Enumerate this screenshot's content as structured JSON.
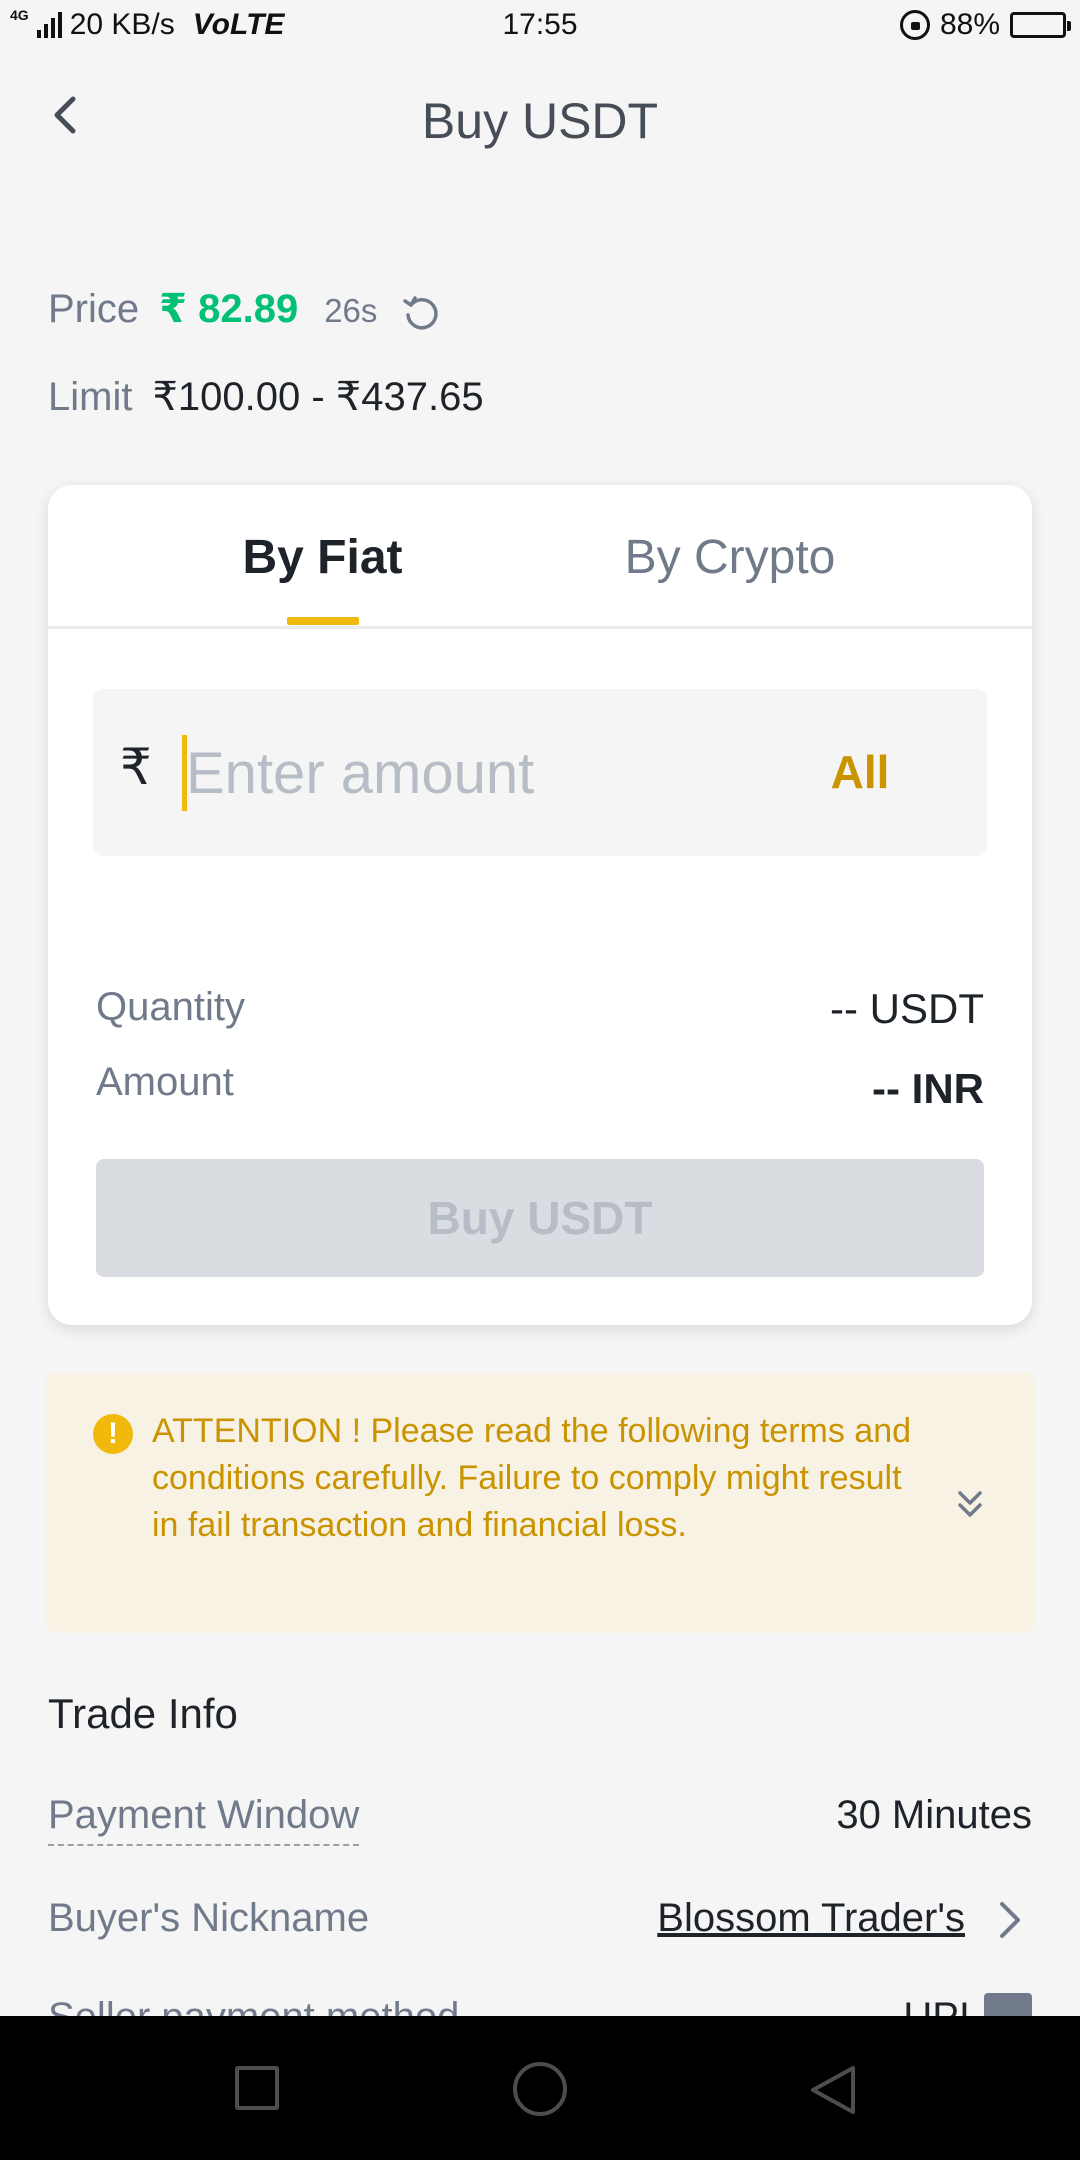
{
  "status_bar": {
    "network_type": "4G",
    "speed": "20 KB/s",
    "volte": "VoLTE",
    "time": "17:55",
    "battery": "88%",
    "battery_level": 0.88
  },
  "header": {
    "title": "Buy USDT",
    "back_icon": "chevron-left-icon"
  },
  "price_info": {
    "price_label": "Price",
    "price_value": "₹ 82.89",
    "countdown": "26s",
    "refresh_icon": "refresh-icon",
    "limit_label": "Limit",
    "limit_value": "₹100.00 - ₹437.65"
  },
  "tabs": [
    {
      "label": "By Fiat",
      "active": true
    },
    {
      "label": "By Crypto",
      "active": false
    }
  ],
  "amount_input": {
    "currency_symbol": "₹",
    "placeholder": "Enter amount",
    "value": "",
    "all_label": "All"
  },
  "summary": {
    "quantity_label": "Quantity",
    "quantity_value": "-- USDT",
    "amount_label": "Amount",
    "amount_value": "-- INR"
  },
  "buy_button": {
    "label": "Buy USDT",
    "disabled": true
  },
  "attention": {
    "icon": "exclamation-circle-icon",
    "text": "ATTENTION ! Please read the following terms and conditions carefully. Failure to comply might result in fail transaction and financial loss.",
    "expand_icon": "double-chevron-down-icon"
  },
  "trade_info": {
    "title": "Trade Info",
    "rows": [
      {
        "label": "Payment Window",
        "value": "30 Minutes"
      },
      {
        "label": "Buyer's Nickname",
        "value": "Blossom Trader's"
      },
      {
        "label": "Seller payment method",
        "value": "UPI"
      }
    ]
  },
  "colors": {
    "accent": "#f0b90b",
    "accent_text": "#c99400",
    "price_green": "#02c076",
    "text_primary": "#1e2329",
    "text_secondary": "#707a8a",
    "attention_bg": "#f8f2e5"
  },
  "nav_bar": {
    "icons": [
      "recent-apps-icon",
      "home-icon",
      "back-triangle-icon"
    ]
  }
}
